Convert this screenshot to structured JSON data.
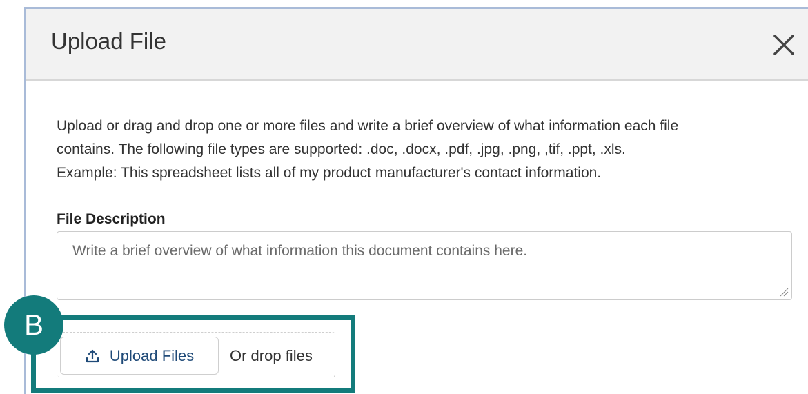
{
  "modal": {
    "title": "Upload File",
    "close_icon": "close-icon"
  },
  "intro": {
    "line1": "Upload or drag and drop one or more files and write a brief overview of what information each file",
    "line2": "contains. The following file types are supported: .doc, .docx, .pdf, .jpg, .png, ,tif, .ppt, .xls.",
    "line3": "Example: This spreadsheet lists all of my product manufacturer's contact information."
  },
  "file_description": {
    "label": "File Description",
    "placeholder": "Write a brief overview of what information this document contains here.",
    "value": ""
  },
  "upload": {
    "button_label": "Upload Files",
    "button_icon": "upload-icon",
    "drop_text": "Or drop files"
  },
  "annotation": {
    "badge_label": "B",
    "color": "#137b7b"
  }
}
